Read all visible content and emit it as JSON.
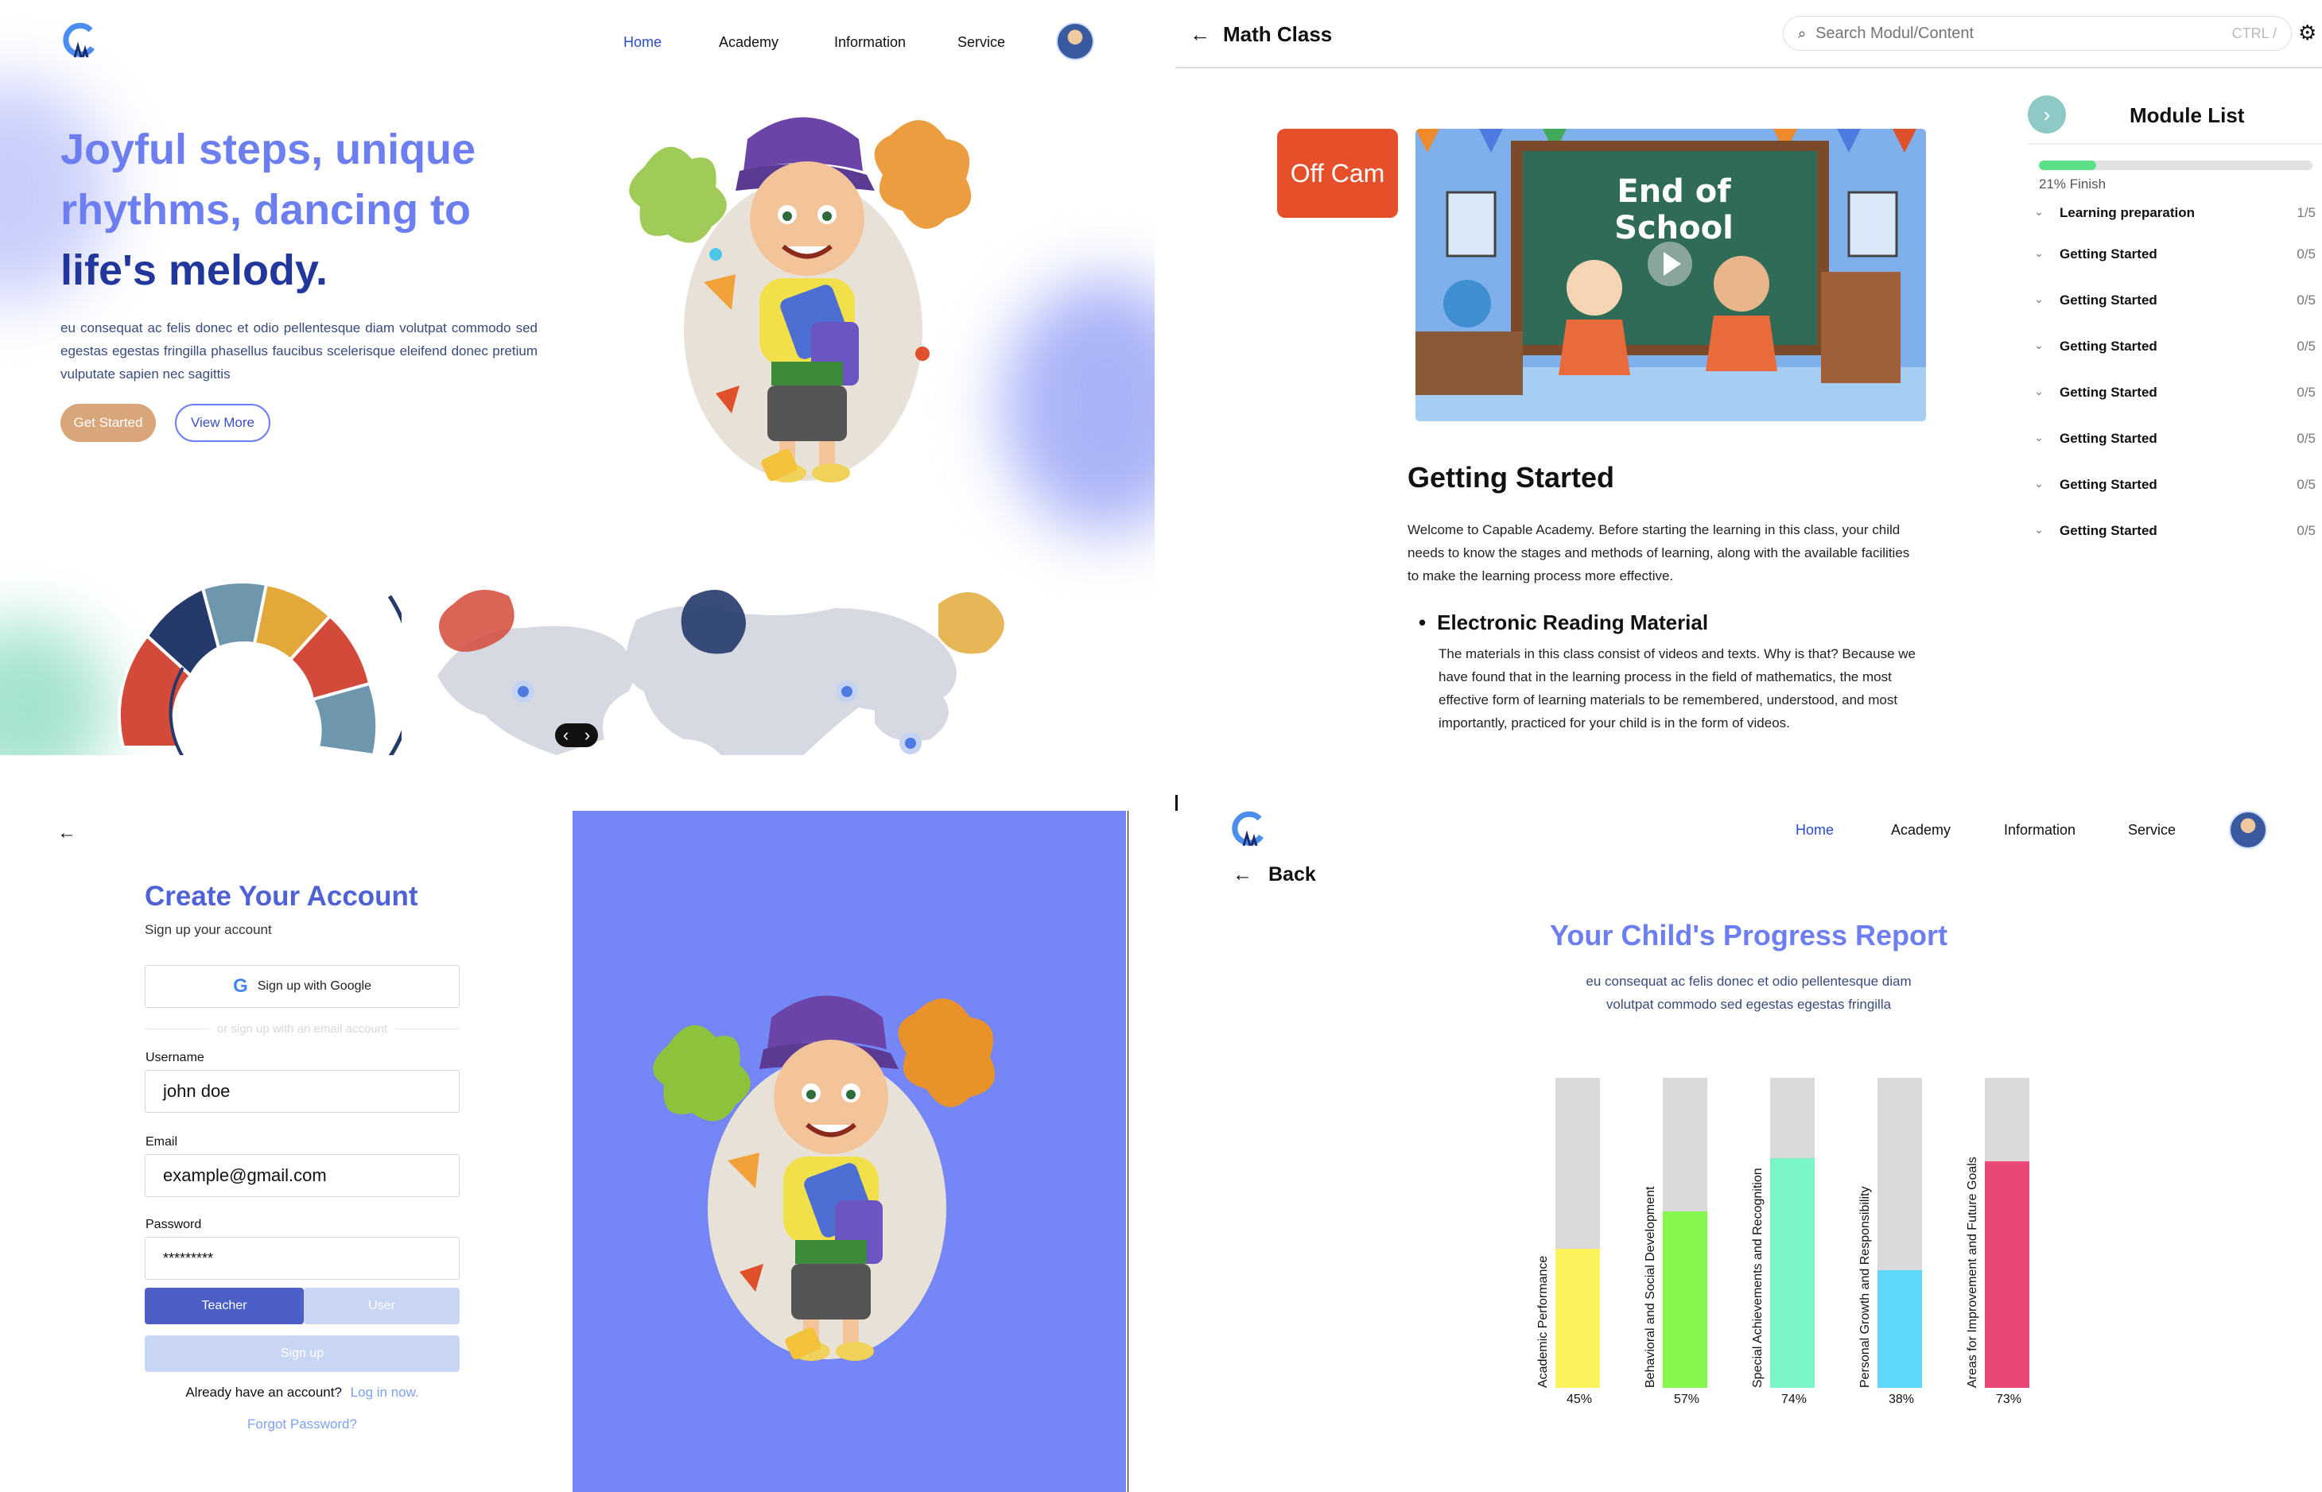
{
  "landing": {
    "nav": [
      "Home",
      "Academy",
      "Information",
      "Service"
    ],
    "hero_line1": "Joyful steps, unique",
    "hero_line2": "rhythms, dancing to",
    "hero_line3": "life's melody.",
    "hero_body": "eu consequat ac felis donec et odio pellentesque diam volutpat commodo sed egestas egestas fringilla phasellus faucibus scelerisque eleifend donec pretium vulputate sapien nec sagittis",
    "get_started": "Get Started",
    "view_more": "View More",
    "carousel_prev": "‹",
    "carousel_next": "›"
  },
  "class": {
    "title": "Math Class",
    "search_placeholder": "Search Modul/Content",
    "search_shortcut": "CTRL /",
    "off_cam": "Off Cam",
    "video_title": "End of School",
    "section_title": "Getting Started",
    "intro": "Welcome to Capable Academy. Before starting the learning in this class, your child needs to know the stages and methods of learning, along with the available facilities to make the learning process more effective.",
    "bullet_title": "Electronic Reading Material",
    "bullet_body": "The materials in this class consist of videos and texts. Why is that? Because we have found that in the learning process in the field of mathematics, the most effective form of learning materials to be remembered, understood, and most importantly, practiced for your child is in the form of videos.",
    "module_list_title": "Module List",
    "progress_text": "21% Finish",
    "progress_value": 0.21,
    "modules": [
      {
        "title": "Learning preparation",
        "count": "1/5"
      },
      {
        "title": "Getting Started",
        "count": "0/5"
      },
      {
        "title": "Getting Started",
        "count": "0/5"
      },
      {
        "title": "Getting Started",
        "count": "0/5"
      },
      {
        "title": "Getting Started",
        "count": "0/5"
      },
      {
        "title": "Getting Started",
        "count": "0/5"
      },
      {
        "title": "Getting Started",
        "count": "0/5"
      },
      {
        "title": "Getting Started",
        "count": "0/5"
      }
    ]
  },
  "signup": {
    "title": "Create Your Account",
    "subtitle": "Sign up your account",
    "google": "Sign up with Google",
    "divider": "or sign up with an email account",
    "username_label": "Username",
    "username_value": "john doe",
    "email_label": "Email",
    "email_value": "example@gmail.com",
    "password_label": "Password",
    "password_value": "*********",
    "role_teacher": "Teacher",
    "role_user": "User",
    "signup_btn": "Sign up",
    "have_account": "Already have an account?",
    "login": "Log in now.",
    "forgot": "Forgot Password?",
    "panel_color": "#7587f7"
  },
  "report": {
    "nav": [
      "Home",
      "Academy",
      "Information",
      "Service"
    ],
    "back": "Back",
    "title": "Your Child's Progress Report",
    "subtitle_line1": "eu consequat ac felis donec et odio pellentesque diam",
    "subtitle_line2": "volutpat commodo sed egestas egestas fringilla"
  },
  "chart_data": {
    "type": "bar",
    "categories": [
      "Academic Performance",
      "Behavioral and Social Development",
      "Special Achievements and Recognition",
      "Personal Growth and Responsibility",
      "Areas for Improvement and Future Goals"
    ],
    "values": [
      45,
      57,
      74,
      38,
      73
    ],
    "value_labels": [
      "45%",
      "57%",
      "74%",
      "38%",
      "73%"
    ],
    "colors": [
      "#fbf35b",
      "#87f750",
      "#7af5c8",
      "#5fd7fb",
      "#e94776"
    ],
    "ylim": [
      0,
      100
    ],
    "title": "",
    "xlabel": "",
    "ylabel": ""
  },
  "colors": {
    "accent": "#6d7ef0",
    "dark_blue": "#22379b",
    "get_started": "#d9a57a",
    "off_cam": "#e5502a",
    "teacher": "#4c5fc7",
    "user": "#c8d6f3"
  }
}
